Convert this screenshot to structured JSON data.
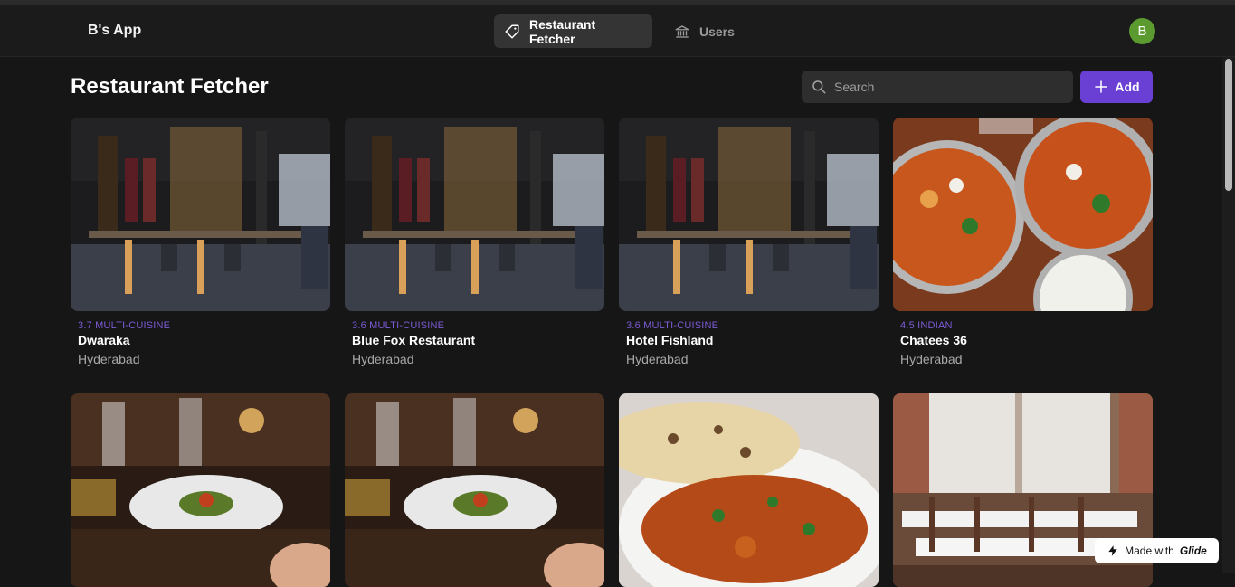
{
  "app": {
    "name": "B's App",
    "avatar_initial": "B"
  },
  "nav": {
    "tabs": [
      {
        "label": "Restaurant Fetcher",
        "icon": "tag-icon",
        "active": true
      },
      {
        "label": "Users",
        "icon": "bank-icon",
        "active": false
      }
    ]
  },
  "page": {
    "title": "Restaurant Fetcher"
  },
  "search": {
    "placeholder": "Search",
    "value": ""
  },
  "toolbar": {
    "add_label": "Add"
  },
  "cards": [
    {
      "tag": "3.7 MULTI-CUISINE",
      "name": "Dwaraka",
      "city": "Hyderabad"
    },
    {
      "tag": "3.6 MULTI-CUISINE",
      "name": "Blue Fox Restaurant",
      "city": "Hyderabad"
    },
    {
      "tag": "3.6 MULTI-CUISINE",
      "name": "Hotel Fishland",
      "city": "Hyderabad"
    },
    {
      "tag": "4.5 INDIAN",
      "name": "Chatees 36",
      "city": "Hyderabad"
    }
  ],
  "badge": {
    "prefix": "Made with",
    "brand": "Glide"
  },
  "colors": {
    "accent": "#6a3fd4",
    "tag": "#7d5cd6",
    "background": "#161616",
    "avatar": "#5a9a2f"
  }
}
